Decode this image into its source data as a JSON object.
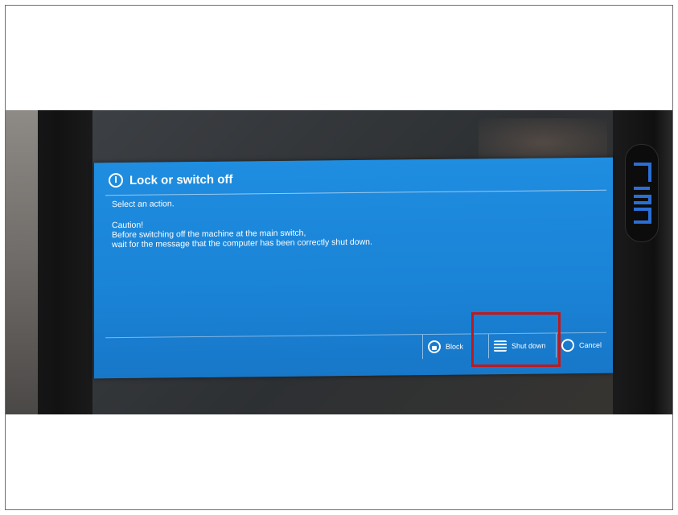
{
  "dialog": {
    "title": "Lock or switch off",
    "prompt": "Select an action.",
    "caution_heading": "Caution!",
    "caution_line1": "Before switching off the machine at the main switch,",
    "caution_line2": "wait for the message that the computer has been correctly shut down.",
    "buttons": {
      "block": "Block",
      "shut_down": "Shut down",
      "cancel": "Cancel"
    }
  },
  "highlight": {
    "target": "Shut down",
    "color": "#c0181b"
  },
  "colors": {
    "dialog_blue": "#1a83d6",
    "text": "#ffffff"
  }
}
